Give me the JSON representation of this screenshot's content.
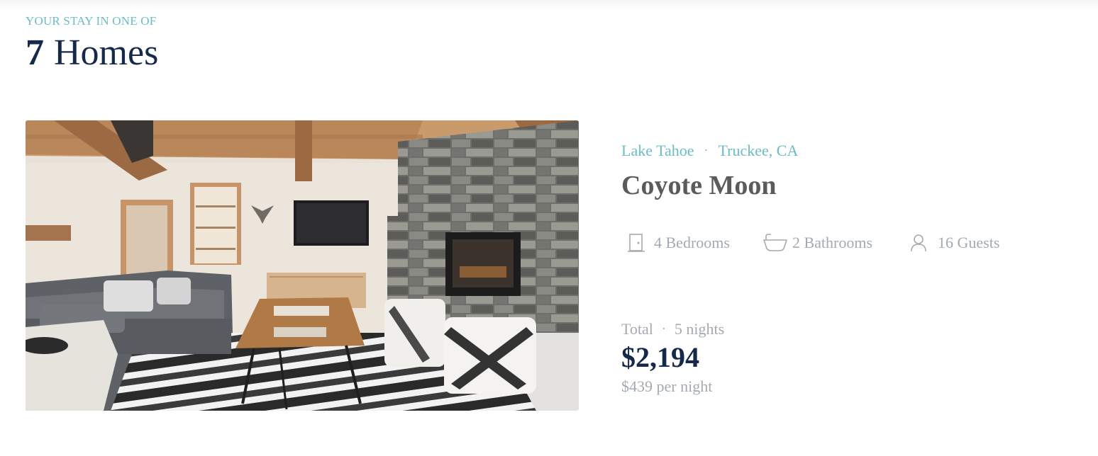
{
  "header": {
    "eyebrow": "YOUR STAY IN ONE OF",
    "count": "7",
    "noun": "Homes"
  },
  "listing": {
    "region": "Lake Tahoe",
    "separator": "·",
    "city": "Truckee, CA",
    "name": "Coyote Moon",
    "amenities": [
      {
        "icon": "door-icon",
        "label": "4 Bedrooms"
      },
      {
        "icon": "bathtub-icon",
        "label": "2 Bathrooms"
      },
      {
        "icon": "person-icon",
        "label": "16 Guests"
      }
    ],
    "pricing": {
      "total_label": "Total",
      "nights": "5 nights",
      "total": "$2,194",
      "per_night": "$439 per night"
    }
  },
  "colors": {
    "accent": "#6bbcc6",
    "navy": "#14294b",
    "muted": "#a4aab1",
    "name_gray": "#5b5b5b"
  }
}
